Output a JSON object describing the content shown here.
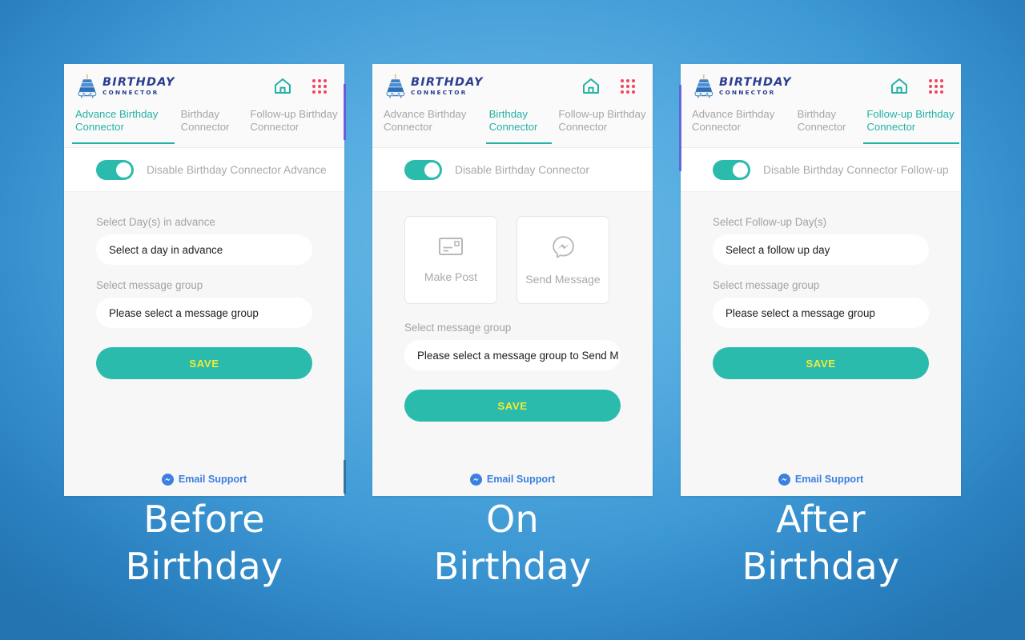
{
  "slide": {
    "background_color": "#3d98d4",
    "accent_teal": "#2bbbad",
    "accent_pink": "#f2455c",
    "brand_navy": "#2a3f8f",
    "save_text_color": "#f2e93a",
    "support_link_color": "#3b7fe0"
  },
  "brand": {
    "title": "BIRTHDAY",
    "subtitle": "CONNECTOR",
    "logo_icon": "birthday-cake-icon"
  },
  "header_icons": {
    "home": "home-icon",
    "apps": "grid-apps-icon"
  },
  "tabs": [
    {
      "label": "Advance Birthday Connector"
    },
    {
      "label": "Birthday Connector"
    },
    {
      "label": "Follow-up Birthday Connector"
    }
  ],
  "panels": [
    {
      "name": "advance-birthday-connector",
      "active_tab_index": 0,
      "toggle": {
        "label": "Disable Birthday Connector Advance",
        "state": "on"
      },
      "fields": [
        {
          "label": "Select Day(s) in advance",
          "value": "Select a day in advance"
        },
        {
          "label": "Select message group",
          "value": "Please select a message group"
        }
      ],
      "actions": [],
      "save_label": "SAVE",
      "support_label": "Email Support",
      "caption_line1": "Before",
      "caption_line2": "Birthday"
    },
    {
      "name": "birthday-connector",
      "active_tab_index": 1,
      "toggle": {
        "label": "Disable Birthday Connector",
        "state": "on"
      },
      "fields": [
        {
          "label": "Select message group",
          "value": "Please select a message group to Send M"
        }
      ],
      "actions": [
        {
          "label": "Make Post",
          "icon": "post-card-icon"
        },
        {
          "label": "Send Message",
          "icon": "messenger-icon"
        }
      ],
      "save_label": "SAVE",
      "support_label": "Email Support",
      "caption_line1": "On",
      "caption_line2": "Birthday"
    },
    {
      "name": "follow-up-birthday-connector",
      "active_tab_index": 2,
      "toggle": {
        "label": "Disable Birthday Connector Follow-up",
        "state": "on"
      },
      "fields": [
        {
          "label": "Select Follow-up Day(s)",
          "value": "Select a follow up day"
        },
        {
          "label": "Select message group",
          "value": "Please select a message group"
        }
      ],
      "actions": [],
      "save_label": "SAVE",
      "support_label": "Email Support",
      "caption_line1": "After",
      "caption_line2": "Birthday"
    }
  ]
}
